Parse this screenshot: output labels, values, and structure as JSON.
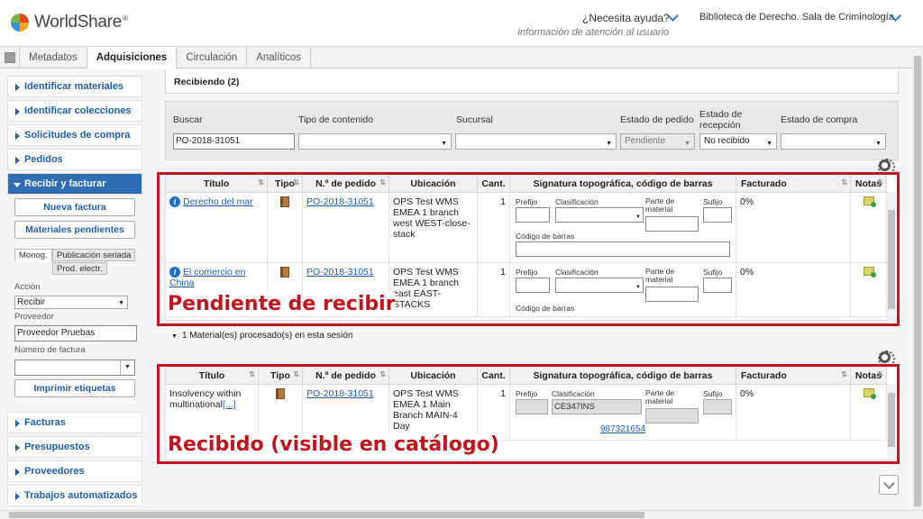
{
  "header": {
    "brand": "WorldShare",
    "help_label": "¿Necesita ayuda?",
    "help_sub": "Información de atención al usuario",
    "library": "Biblioteca de Derecho. Sala de Criminología"
  },
  "tabs": [
    "Metadatos",
    "Adquisiciones",
    "Circulación",
    "Analíticos"
  ],
  "active_tab": "Adquisiciones",
  "sidebar": {
    "items_top": [
      "Identificar materiales",
      "Identificar colecciones",
      "Solicitudes de compra",
      "Pedidos"
    ],
    "open_item": "Recibir y facturar",
    "buttons": [
      "Nueva factura",
      "Materiales pendientes"
    ],
    "subtabs": [
      "Monog.",
      "Publicación seriada",
      "Prod. electr."
    ],
    "accion_label": "Acción",
    "accion_value": "Recibir",
    "proveedor_label": "Proveedor",
    "proveedor_value": "Proveedor Pruebas",
    "factura_label": "Número de factura",
    "print_button": "Imprimir etiquetas",
    "items_bottom": [
      "Facturas",
      "Presupuestos",
      "Proveedores",
      "Trabajos automatizados"
    ]
  },
  "receiving": {
    "title": "Recibiendo (2)"
  },
  "filters": {
    "buscar_label": "Buscar",
    "buscar_value": "PO-2018-31051",
    "tipo_label": "Tipo de contenido",
    "sucursal_label": "Sucursal",
    "estado_pedido_label": "Estado de pedido",
    "estado_pedido_value": "Pendiente",
    "estado_recepcion_label": "Estado de recepción",
    "estado_recepcion_value": "No recibido",
    "estado_compra_label": "Estado de compra"
  },
  "columns": [
    "Título",
    "Tipo",
    "N.º de pedido",
    "Ubicación",
    "Cant.",
    "Signatura topográfica, código de barras",
    "Facturado",
    "Notas"
  ],
  "field_labels": {
    "prefijo": "Prefijo",
    "clasificacion": "Clasificación",
    "parte": "Parte de material",
    "sufijo": "Sufijo",
    "codigo": "Código de barras"
  },
  "pending_rows": [
    {
      "title": "Derecho del mar",
      "order": "PO-2018-31051",
      "location": "OPS Test WMS EMEA 1 branch west WEST-close-stack",
      "qty": "1",
      "billed": "0%"
    },
    {
      "title": "El comercio en China",
      "order": "PO-2018-31051",
      "location": "OPS Test WMS EMEA 1 branch east EAST-STACKS",
      "qty": "1",
      "billed": "0%"
    }
  ],
  "processed_label": "1 Material(es) procesado(s) en esta sesión",
  "received_rows": [
    {
      "title": "Insolvency within multinational",
      "more": "[...]",
      "order": "PO-2018-31051",
      "location": "OPS Test WMS EMEA 1 Main Branch MAIN-4 Day",
      "qty": "1",
      "classification": "CE347INS",
      "barcode": "987321654",
      "billed": "0%"
    }
  ],
  "annotations": {
    "pending": "Pendiente de recibir",
    "received": "Recibido (visible en catálogo)"
  },
  "colors": {
    "accent": "#2d6db0",
    "annotation": "#c0141f"
  }
}
